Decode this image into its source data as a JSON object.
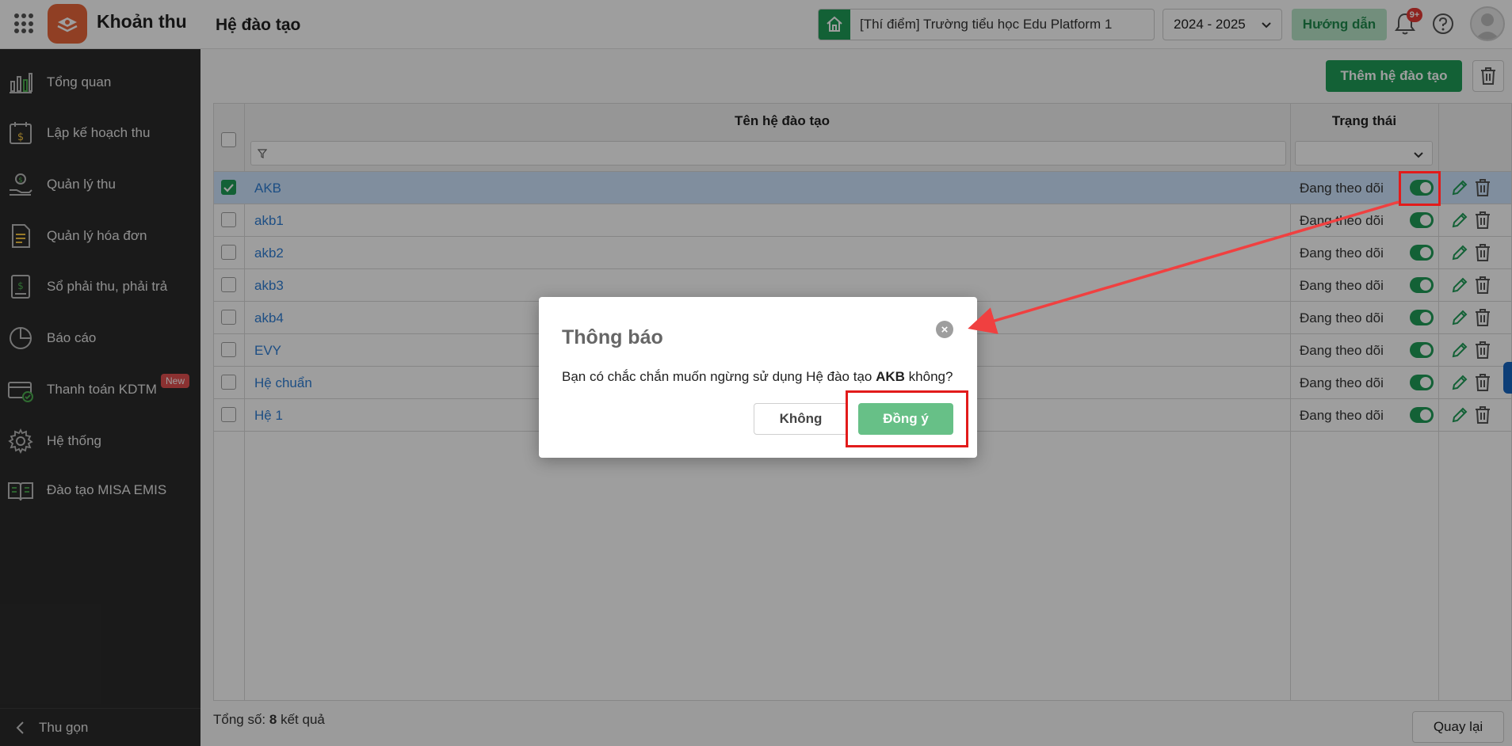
{
  "app": {
    "title": "Khoản thu",
    "page_title": "Hệ đào tạo"
  },
  "header": {
    "school": "[Thí điểm] Trường tiểu học Edu Platform 1",
    "year": "2024 - 2025",
    "guide_label": "Hướng dẫn",
    "notif_badge": "9+"
  },
  "sidebar": {
    "items": [
      {
        "label": "Tổng quan",
        "icon": "chart-bars-icon"
      },
      {
        "label": "Lập kế hoạch thu",
        "icon": "calendar-money-icon"
      },
      {
        "label": "Quản lý thu",
        "icon": "hand-coin-icon"
      },
      {
        "label": "Quản lý hóa đơn",
        "icon": "invoice-icon"
      },
      {
        "label": "Sổ phải thu, phải trả",
        "icon": "ledger-icon"
      },
      {
        "label": "Báo cáo",
        "icon": "pie-chart-icon"
      },
      {
        "label": "Thanh toán KDTM",
        "icon": "card-check-icon",
        "badge": "New"
      },
      {
        "label": "Hệ thống",
        "icon": "gear-icon"
      },
      {
        "label": "Đào tạo MISA EMIS",
        "icon": "book-open-icon"
      }
    ],
    "collapse_label": "Thu gọn"
  },
  "toolbar": {
    "add_label": "Thêm hệ đào tạo"
  },
  "table": {
    "columns": {
      "name": "Tên hệ đào tạo",
      "status": "Trạng thái"
    },
    "rows": [
      {
        "name": "AKB",
        "status": "Đang theo dõi",
        "selected": true
      },
      {
        "name": "akb1",
        "status": "Đang theo dõi"
      },
      {
        "name": "akb2",
        "status": "Đang theo dõi"
      },
      {
        "name": "akb3",
        "status": "Đang theo dõi"
      },
      {
        "name": "akb4",
        "status": "Đang theo dõi"
      },
      {
        "name": "EVY",
        "status": "Đang theo dõi"
      },
      {
        "name": "Hệ chuẩn",
        "status": "Đang theo dõi"
      },
      {
        "name": "Hệ 1",
        "status": "Đang theo dõi"
      }
    ]
  },
  "footer": {
    "total_prefix": "Tổng số:",
    "total_count": "8",
    "total_suffix": "kết quả",
    "back_label": "Quay lại"
  },
  "dialog": {
    "title": "Thông báo",
    "message_prefix": "Bạn có chắc chắn muốn ngừng sử dụng Hệ đào tạo",
    "message_item": "AKB",
    "message_suffix": "không?",
    "no_label": "Không",
    "yes_label": "Đồng ý"
  },
  "colors": {
    "primary": "#1f9d57",
    "sidebar": "#2b2b2b",
    "link": "#2f7fd6",
    "highlight": "#e21b1b"
  }
}
